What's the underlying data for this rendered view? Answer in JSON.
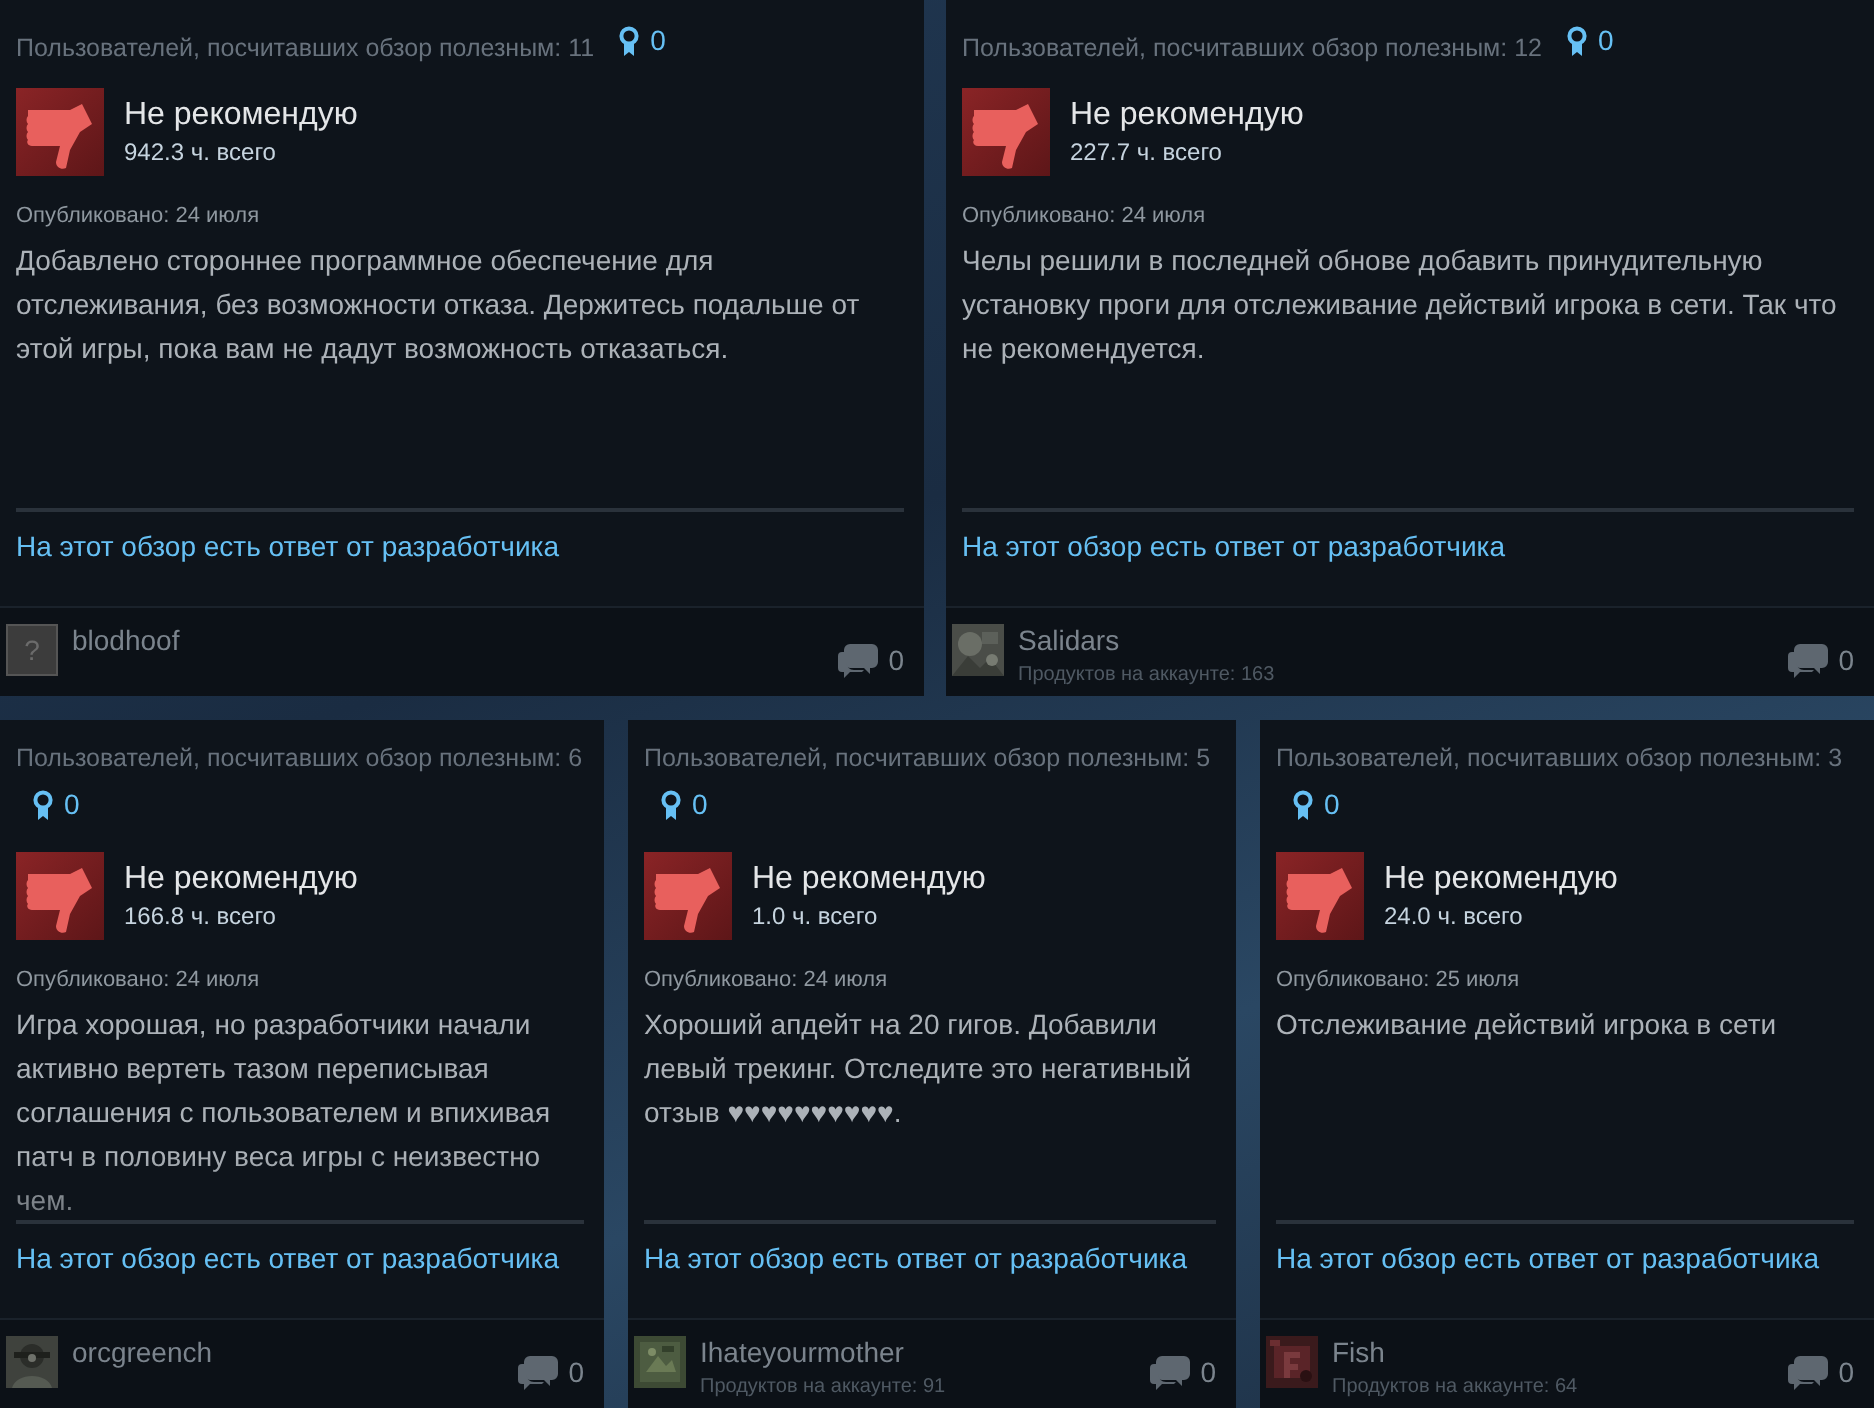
{
  "reviews": [
    {
      "helpful": "Пользователей, посчитавших обзор полезным: 11",
      "awards": "0",
      "verdict": "Не рекомендую",
      "hours": "942.3 ч. всего",
      "posted": "Опубликовано: 24 июля",
      "body": "Добавлено стороннее программное обеспечение для отслеживания, без возможности отказа. Держитесь подальше от этой игры, пока вам не дадут возможность отказаться.",
      "dev_response": "На этот обзор есть ответ от разработчика",
      "author": {
        "name": "blodhoof",
        "avatar": {
          "kind": "default",
          "glyph": "?"
        }
      },
      "comments": "0"
    },
    {
      "helpful": "Пользователей, посчитавших обзор полезным: 12",
      "awards": "0",
      "verdict": "Не рекомендую",
      "hours": "227.7 ч. всего",
      "posted": "Опубликовано: 24 июля",
      "body": "Челы решили в последней обнове добавить принудительную установку проги для отслеживание действий игрока в сети. Так что не рекомендуется.",
      "dev_response": "На этот обзор есть ответ от разработчика",
      "author": {
        "name": "Salidars",
        "products": "Продуктов на аккаунте: 163"
      },
      "comments": "0"
    },
    {
      "helpful": "Пользователей, посчитавших обзор полезным: 6",
      "awards": "0",
      "verdict": "Не рекомендую",
      "hours": "166.8 ч. всего",
      "posted": "Опубликовано: 24 июля",
      "body": "Игра хорошая, но разработчики начали активно вертеть тазом переписывая соглашения с пользователем и впихивая патч в половину веса игры с неизвестно чем.",
      "dev_response": "На этот обзор есть ответ от разработчика",
      "author": {
        "name": "orcgreench"
      },
      "comments": "0"
    },
    {
      "helpful": "Пользователей, посчитавших обзор полезным: 5",
      "awards": "0",
      "verdict": "Не рекомендую",
      "hours": "1.0 ч. всего",
      "posted": "Опубликовано: 24 июля",
      "body": "Хороший апдейт на 20 гигов. Добавили левый трекинг. Отследите это негативный отзыв ♥♥♥♥♥♥♥♥♥♥.",
      "dev_response": "На этот обзор есть ответ от разработчика",
      "author": {
        "name": "Ihateyourmother",
        "products": "Продуктов на аккаунте: 91"
      },
      "comments": "0"
    },
    {
      "helpful": "Пользователей, посчитавших обзор полезным: 3",
      "awards": "0",
      "verdict": "Не рекомендую",
      "hours": "24.0 ч. всего",
      "posted": "Опубликовано: 25 июля",
      "body": "Отслеживание действий игрока в сети",
      "dev_response": "На этот обзор есть ответ от разработчика",
      "author": {
        "name": "Fish",
        "products": "Продуктов на аккаунте: 64"
      },
      "comments": "0"
    }
  ]
}
